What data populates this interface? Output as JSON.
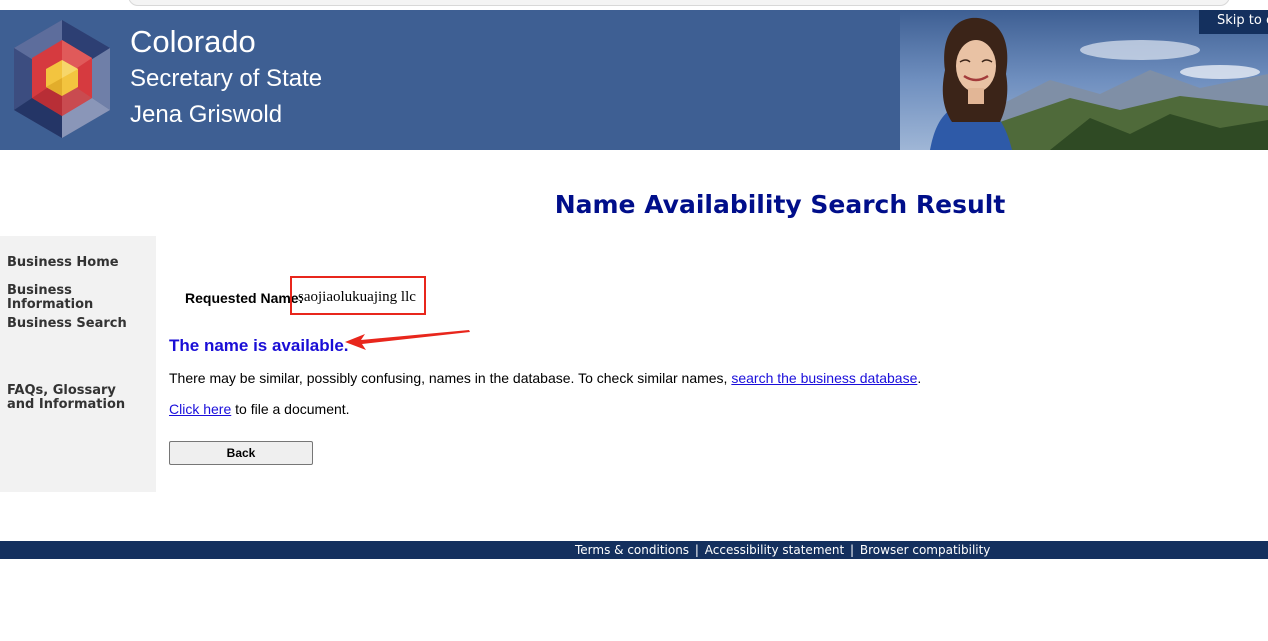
{
  "header": {
    "state": "Colorado",
    "office": "Secretary of State",
    "official": "Jena Griswold",
    "skip_link": "Skip to content"
  },
  "page": {
    "title": "Name Availability Search Result"
  },
  "sidebar": {
    "items": [
      {
        "label": "Business Home"
      },
      {
        "label": "Business Information"
      },
      {
        "label": "Business Search"
      },
      {
        "label": "FAQs, Glossary and Information"
      }
    ]
  },
  "result": {
    "requested_label": "Requested Name:",
    "requested_value": "saojiaolukuajing llc",
    "status": "The name is available.",
    "similar_text": "There may be similar, possibly confusing, names in the database. To check similar names, ",
    "similar_link": "search the business database",
    "similar_end": ".",
    "click_link": "Click here",
    "click_text": " to file a document.",
    "back_label": "Back"
  },
  "footer": {
    "links": [
      "Terms & conditions",
      "Accessibility statement",
      "Browser compatibility"
    ],
    "separator": "|"
  },
  "colors": {
    "header_bg": "#3e5f93",
    "footer_bg": "#14305e",
    "title": "#000e8a",
    "status": "#1a0ed6",
    "annotation": "#e8261c"
  }
}
